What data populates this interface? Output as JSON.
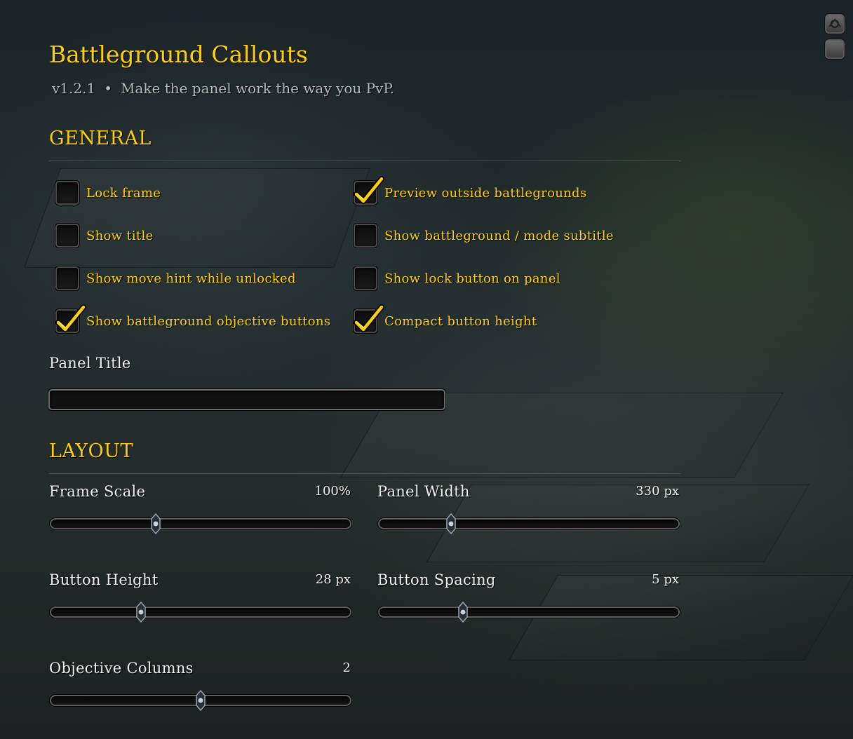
{
  "header": {
    "title": "Battleground Callouts",
    "version": "v1.2.1",
    "separator": "•",
    "tagline": "Make the panel work the way you PvP."
  },
  "general": {
    "heading": "GENERAL",
    "checkboxes": [
      {
        "label": "Lock frame",
        "checked": false
      },
      {
        "label": "Preview outside battlegrounds",
        "checked": true
      },
      {
        "label": "Show title",
        "checked": false
      },
      {
        "label": "Show battleground / mode subtitle",
        "checked": false
      },
      {
        "label": "Show move hint while unlocked",
        "checked": false
      },
      {
        "label": "Show lock button on panel",
        "checked": false
      },
      {
        "label": "Show battleground objective buttons",
        "checked": true
      },
      {
        "label": "Compact button height",
        "checked": true
      }
    ],
    "panel_title_label": "Panel Title",
    "panel_title_value": ""
  },
  "layout": {
    "heading": "LAYOUT",
    "sliders": [
      {
        "label": "Frame Scale",
        "value": "100%",
        "fraction": 0.35
      },
      {
        "label": "Panel Width",
        "value": "330 px",
        "fraction": 0.24
      },
      {
        "label": "Button Height",
        "value": "28 px",
        "fraction": 0.3
      },
      {
        "label": "Button Spacing",
        "value": "5 px",
        "fraction": 0.28
      },
      {
        "label": "Objective Columns",
        "value": "2",
        "fraction": 0.5
      }
    ]
  },
  "colors": {
    "accent_gold": "#ffd100",
    "label_white": "#f0f0f0",
    "muted_gray": "#b9b9b9"
  },
  "icons": [
    "checkmark-icon",
    "slider-thumb-icon",
    "map-pin-icon",
    "square-icon"
  ]
}
